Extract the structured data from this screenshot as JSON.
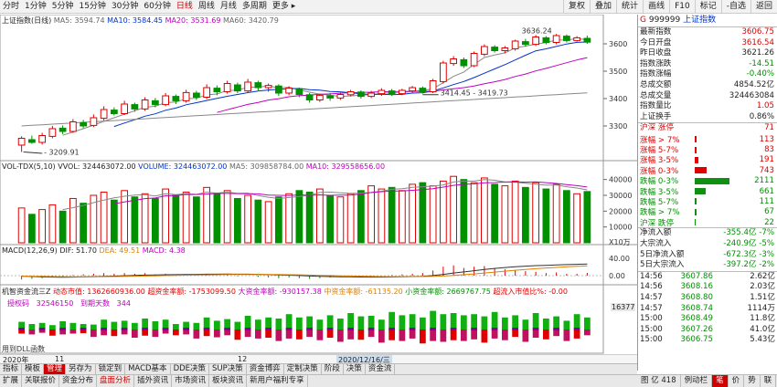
{
  "toolbar": {
    "periods": [
      "分时",
      "1分钟",
      "5分钟",
      "15分钟",
      "30分钟",
      "60分钟",
      "日线",
      "周线",
      "月线",
      "多周期",
      "更多 ▸"
    ],
    "active_period": "日线",
    "right_buttons": [
      "复权",
      "叠加",
      "统计",
      "画线",
      "F10",
      "标记",
      "-自选",
      "返回"
    ]
  },
  "main": {
    "title": "上证指数(日线)",
    "ma5": "MA5: 3594.74",
    "ma10": "MA10: 3584.45",
    "ma20": "MA20: 3531.69",
    "ma60": "MA60: 3420.79",
    "price_labels": [
      "3600",
      "3500",
      "3400",
      "3300"
    ],
    "annot_high": "3636.24",
    "annot_low": "3209.91",
    "annot_mid": "3414.45 - 3419.73"
  },
  "volume": {
    "title": "VOL-TDX(5,10)",
    "vvol": "VVOL: 324463072.00",
    "volume": "VOLUME: 324463072.00",
    "ma5": "MA5: 309858784.00",
    "ma10": "MA10: 329558656.00",
    "labels": [
      "40000",
      "30000",
      "20000",
      "10000"
    ],
    "unit": "X10万"
  },
  "macd": {
    "title": "MACD(12,26,9)",
    "dif": "DIF: 51.70",
    "dea": "DEA: 49.51",
    "macd": "MACD: 4.38",
    "labels": [
      "40.00",
      "0.00"
    ]
  },
  "fund": {
    "title": "机智资金流三Z",
    "dtsz": "动态市值: 1362660936.00",
    "cdd": "超资金率额: -1753099.50",
    "dd": "大资金率额: -930157.38",
    "zd": "中资金率额: -61135.20",
    "xd": "小资金率额: 2669767.75",
    "cd_ratio": "超流入市值比%: -0.00",
    "qx": "授权码",
    "qx_val": "32546150",
    "days": "到期天数",
    "days_val": "344",
    "side_val": "16377",
    "footer": "用到DLL函数"
  },
  "datebar": {
    "left": "2020年",
    "mid1": "11",
    "mid2": "12",
    "date": "2020/12/16/三"
  },
  "tabs1": [
    "指标",
    "模板",
    "管理",
    "另存为",
    "锁定到",
    "MACD基本",
    "DDE决策",
    "SUP决策",
    "资金博弈",
    "定制决策",
    "阶段",
    "决策",
    "资金流"
  ],
  "tabs1_active": "管理",
  "tabs2": [
    "扩展",
    "关联报价",
    "资金分布",
    "盘面分析",
    "插外资讯",
    "市场资讯",
    "板块资讯",
    "新用户福利专享"
  ],
  "tabs2_active": "盘面分析",
  "tabs3": [
    "图 亿 418",
    "例动栏",
    "笔",
    "价",
    "势",
    "联",
    "值"
  ],
  "tabs3_active": "笔",
  "panel": {
    "code": "999999",
    "name": "上证指数",
    "quote": [
      {
        "k": "最新指数",
        "v": "3606.75",
        "c": "red"
      },
      {
        "k": "今日开盘",
        "v": "3616.54",
        "c": "red"
      },
      {
        "k": "昨日收盘",
        "v": "3621.26",
        "c": ""
      },
      {
        "k": "指数涨跌",
        "v": "-14.51",
        "c": "green"
      },
      {
        "k": "指数涨幅",
        "v": "-0.40%",
        "c": "green"
      },
      {
        "k": "总成交额",
        "v": "4854.52亿",
        "c": ""
      },
      {
        "k": "总成交量",
        "v": "324463084",
        "c": ""
      },
      {
        "k": "指数量比",
        "v": "1.05",
        "c": "red"
      },
      {
        "k": "上证换手",
        "v": "0.86%",
        "c": ""
      }
    ],
    "dist_header": {
      "k": "沪深 涨停",
      "n": "71"
    },
    "dist": [
      {
        "k": "涨幅 > 7%",
        "n": "113",
        "c": "red",
        "w": 4
      },
      {
        "k": "涨幅 5-7%",
        "n": "83",
        "c": "red",
        "w": 3
      },
      {
        "k": "涨幅 3-5%",
        "n": "191",
        "c": "red",
        "w": 6
      },
      {
        "k": "涨幅 0-3%",
        "n": "743",
        "c": "red",
        "w": 22
      },
      {
        "k": "跌幅 0-3%",
        "n": "2111",
        "c": "green",
        "w": 62
      },
      {
        "k": "跌幅 3-5%",
        "n": "661",
        "c": "green",
        "w": 20
      },
      {
        "k": "跌幅 5-7%",
        "n": "111",
        "c": "green",
        "w": 4
      },
      {
        "k": "跌幅 > 7%",
        "n": "67",
        "c": "green",
        "w": 3
      },
      {
        "k": "沪深 跌停",
        "n": "22",
        "c": "green",
        "w": 1
      }
    ],
    "flow": [
      {
        "k": "净流入额",
        "v": "-355.4亿",
        "p": "-7%"
      },
      {
        "k": "大宗流入",
        "v": "-240.9亿",
        "p": "-5%"
      },
      {
        "k": "5日净流入额",
        "v": "-672.3亿",
        "p": "-3%"
      },
      {
        "k": "5日大宗流入",
        "v": "-397.2亿",
        "p": "-2%"
      }
    ],
    "ticks": [
      {
        "t": "14:56",
        "p": "3607.86",
        "v": "2.62亿"
      },
      {
        "t": "14:56",
        "p": "3608.16",
        "v": "2.03亿"
      },
      {
        "t": "14:57",
        "p": "3608.80",
        "v": "1.51亿"
      },
      {
        "t": "14:57",
        "p": "3608.74",
        "v": "1114万"
      },
      {
        "t": "15:00",
        "p": "3608.49",
        "v": "11.8亿"
      },
      {
        "t": "15:00",
        "p": "3607.26",
        "v": "41.0亿"
      },
      {
        "t": "15:00",
        "p": "3606.75",
        "v": "5.43亿"
      }
    ]
  },
  "colors": {
    "up": "#e00000",
    "down": "#009000",
    "ma5": "#888888",
    "ma10": "#0033cc",
    "ma20": "#c000c0",
    "ma60": "#888888"
  },
  "chart_data": {
    "type": "candlestick",
    "ylim": [
      3180,
      3660
    ],
    "candles": [
      [
        3230,
        3255,
        3205,
        3262
      ],
      [
        3250,
        3240,
        3235,
        3265
      ],
      [
        3240,
        3265,
        3232,
        3275
      ],
      [
        3262,
        3290,
        3255,
        3300
      ],
      [
        3292,
        3280,
        3270,
        3302
      ],
      [
        3280,
        3315,
        3275,
        3325
      ],
      [
        3312,
        3300,
        3292,
        3322
      ],
      [
        3302,
        3330,
        3296,
        3342
      ],
      [
        3328,
        3360,
        3320,
        3372
      ],
      [
        3358,
        3345,
        3338,
        3368
      ],
      [
        3345,
        3380,
        3340,
        3392
      ],
      [
        3378,
        3362,
        3352,
        3385
      ],
      [
        3362,
        3395,
        3355,
        3405
      ],
      [
        3392,
        3378,
        3368,
        3402
      ],
      [
        3378,
        3410,
        3372,
        3420
      ],
      [
        3408,
        3392,
        3380,
        3415
      ],
      [
        3392,
        3422,
        3385,
        3432
      ],
      [
        3420,
        3405,
        3395,
        3428
      ],
      [
        3405,
        3440,
        3398,
        3452
      ],
      [
        3438,
        3425,
        3412,
        3448
      ],
      [
        3425,
        3455,
        3418,
        3465
      ],
      [
        3450,
        3428,
        3420,
        3458
      ],
      [
        3428,
        3460,
        3422,
        3472
      ],
      [
        3458,
        3440,
        3430,
        3465
      ],
      [
        3440,
        3448,
        3425,
        3455
      ],
      [
        3446,
        3420,
        3410,
        3452
      ],
      [
        3420,
        3438,
        3412,
        3445
      ],
      [
        3436,
        3415,
        3405,
        3440
      ],
      [
        3414,
        3395,
        3385,
        3420
      ],
      [
        3395,
        3412,
        3388,
        3418
      ],
      [
        3410,
        3402,
        3392,
        3420
      ],
      [
        3402,
        3415,
        3395,
        3422
      ],
      [
        3414,
        3425,
        3408,
        3432
      ],
      [
        3424,
        3408,
        3400,
        3430
      ],
      [
        3408,
        3420,
        3402,
        3428
      ],
      [
        3418,
        3430,
        3410,
        3438
      ],
      [
        3428,
        3418,
        3410,
        3435
      ],
      [
        3418,
        3430,
        3412,
        3436
      ],
      [
        3428,
        3440,
        3420,
        3446
      ],
      [
        3438,
        3425,
        3418,
        3444
      ],
      [
        3425,
        3465,
        3420,
        3472
      ],
      [
        3462,
        3530,
        3455,
        3538
      ],
      [
        3528,
        3545,
        3520,
        3555
      ],
      [
        3542,
        3520,
        3512,
        3550
      ],
      [
        3520,
        3565,
        3515,
        3572
      ],
      [
        3562,
        3590,
        3555,
        3598
      ],
      [
        3588,
        3575,
        3568,
        3595
      ],
      [
        3575,
        3585,
        3565,
        3592
      ],
      [
        3582,
        3610,
        3575,
        3615
      ],
      [
        3608,
        3598,
        3590,
        3618
      ],
      [
        3598,
        3625,
        3592,
        3632
      ],
      [
        3622,
        3605,
        3598,
        3628
      ],
      [
        3605,
        3630,
        3598,
        3636
      ],
      [
        3628,
        3612,
        3605,
        3634
      ],
      [
        3612,
        3622,
        3608,
        3628
      ],
      [
        3620,
        3606,
        3600,
        3630
      ]
    ],
    "volume": [
      22000,
      18000,
      21000,
      24000,
      20000,
      28000,
      25000,
      30000,
      32000,
      27000,
      33000,
      29000,
      31000,
      28000,
      34000,
      30000,
      32000,
      29000,
      35000,
      31000,
      33000,
      28000,
      30000,
      27000,
      26000,
      29000,
      31000,
      33000,
      32000,
      34000,
      30000,
      29000,
      31000,
      33000,
      36000,
      34000,
      35000,
      33000,
      37000,
      38000,
      36000,
      39000,
      42000,
      40000,
      38000,
      41000,
      37000,
      36000,
      39000,
      35000,
      38000,
      34000,
      37000,
      33000,
      31000,
      32400
    ],
    "macd": [
      -6,
      -5,
      -4,
      -2,
      -1,
      1,
      2,
      3,
      4,
      3,
      4,
      3,
      4,
      2,
      3,
      1,
      2,
      1,
      2,
      0,
      1,
      -1,
      0,
      -2,
      -3,
      -4,
      -3,
      -4,
      -5,
      -4,
      -3,
      -2,
      -1,
      -2,
      -1,
      0,
      1,
      2,
      3,
      4,
      8,
      14,
      16,
      12,
      14,
      15,
      12,
      10,
      9,
      7,
      6,
      4,
      5,
      3,
      3,
      4.38
    ],
    "fund": [
      14,
      -10,
      12,
      -8,
      15,
      -12,
      10,
      -9,
      18,
      -14,
      16,
      -12,
      20,
      -15,
      18,
      -10,
      14,
      -12,
      22,
      -16,
      19,
      -14,
      25,
      -18,
      22,
      -20,
      28,
      -22,
      24,
      -18,
      26,
      -20,
      30,
      -24,
      25,
      -18,
      32,
      -26,
      28,
      -22,
      34,
      -28,
      30,
      -26,
      28,
      -24,
      32,
      -22,
      26,
      -18,
      30,
      -20,
      24,
      -16,
      28,
      -22
    ]
  }
}
